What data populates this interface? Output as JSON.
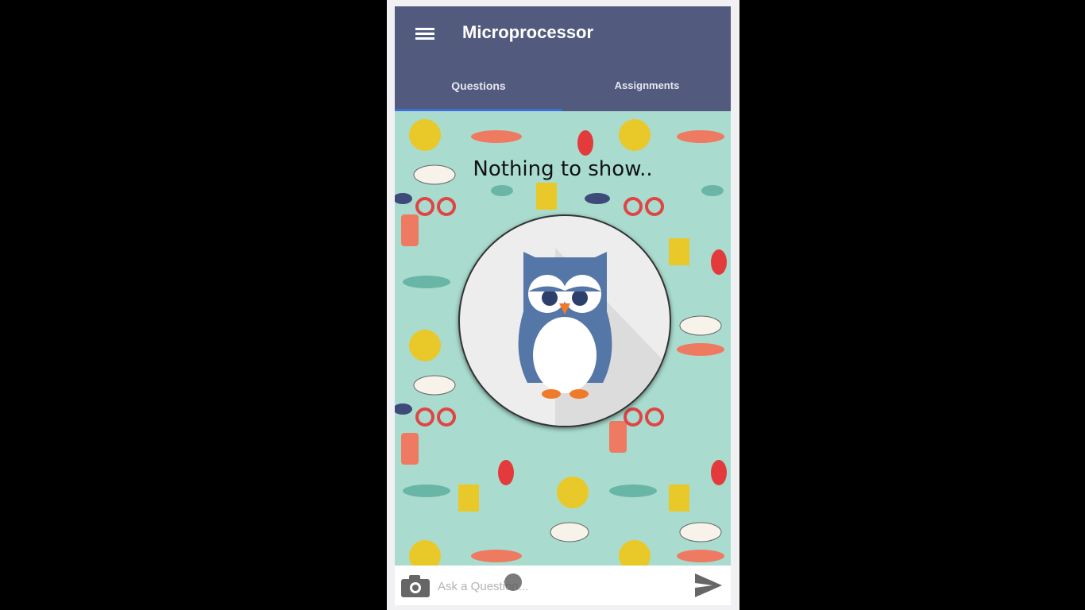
{
  "header": {
    "title": "Microprocessor"
  },
  "tabs": [
    {
      "label": "Questions",
      "active": true
    },
    {
      "label": "Assignments",
      "active": false
    }
  ],
  "empty_state": {
    "message": "Nothing to show.."
  },
  "composer": {
    "placeholder": "Ask a Question..."
  },
  "colors": {
    "appbar": "#525a7e",
    "indicator": "#3c6fd9",
    "background": "#a9dccf"
  }
}
